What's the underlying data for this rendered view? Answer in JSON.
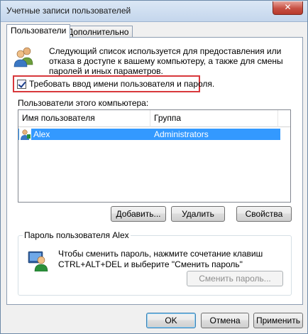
{
  "window": {
    "title": "Учетные записи пользователей",
    "close_label": "✕"
  },
  "tabs": [
    {
      "label": "Пользователи",
      "active": true
    },
    {
      "label": "Дополнительно",
      "active": false
    }
  ],
  "intro": {
    "icon": "users-icon",
    "text": "Следующий список используется для предоставления или отказа в доступе к вашему компьютеру, а также для смены паролей и иных параметров."
  },
  "require_login": {
    "checked": true,
    "label": "Требовать ввод имени пользователя и пароля."
  },
  "users_list": {
    "caption": "Пользователи этого компьютера:",
    "columns": [
      "Имя пользователя",
      "Группа"
    ],
    "rows": [
      {
        "icon": "user-icon",
        "name": "Alex",
        "group": "Administrators",
        "selected": true
      }
    ]
  },
  "list_buttons": {
    "add": "Добавить...",
    "remove": "Удалить",
    "properties": "Свойства"
  },
  "password_group": {
    "title": "Пароль пользователя Alex",
    "icon": "password-user-icon",
    "text": "Чтобы сменить пароль, нажмите сочетание клавиш CTRL+ALT+DEL и выберите \"Сменить пароль\"",
    "button": "Сменить пароль..."
  },
  "dialog_buttons": {
    "ok": "OK",
    "cancel": "Отмена",
    "apply": "Применить"
  },
  "colors": {
    "selection": "#3399ff",
    "highlight_border": "#d8383c"
  }
}
